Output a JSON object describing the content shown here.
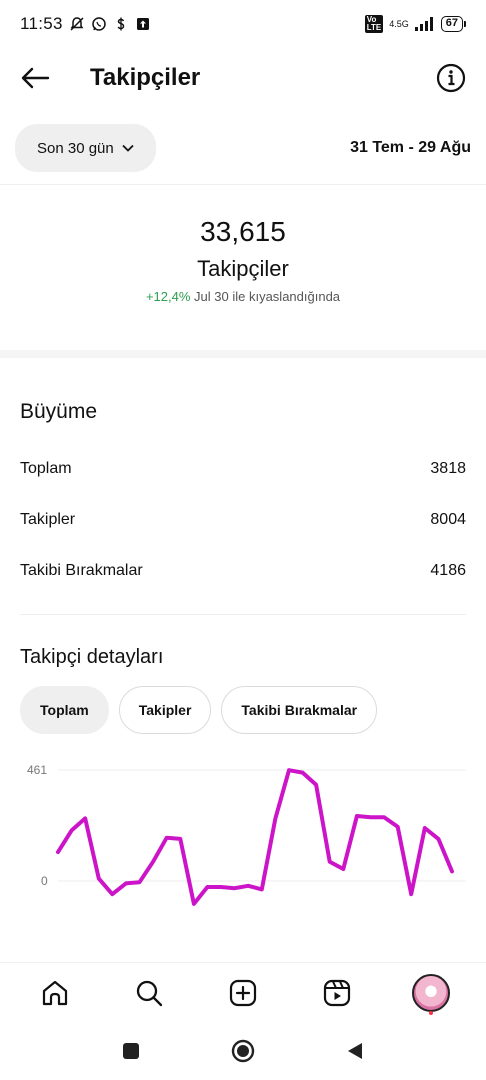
{
  "status_bar": {
    "time": "11:53",
    "network": "4.5G",
    "battery": "67"
  },
  "header": {
    "title": "Takipçiler"
  },
  "date_filter": {
    "range_label": "Son 30 gün",
    "date_range": "31 Tem - 29 Ağu"
  },
  "summary": {
    "count": "33,615",
    "label": "Takipçiler",
    "change": "+12,4%",
    "compare_text": "Jul 30 ile kıyaslandığında"
  },
  "growth": {
    "title": "Büyüme",
    "rows": [
      {
        "label": "Toplam",
        "value": "3818"
      },
      {
        "label": "Takipler",
        "value": "8004"
      },
      {
        "label": "Takibi Bırakmalar",
        "value": "4186"
      }
    ]
  },
  "details": {
    "title": "Takipçi detayları",
    "filters": [
      "Toplam",
      "Takipler",
      "Takibi Bırakmalar"
    ],
    "active_filter": "Toplam"
  },
  "chart_data": {
    "type": "line",
    "y_tick_labels": [
      "461",
      "0"
    ],
    "ylim": [
      0,
      461
    ],
    "color": "#cc14c8",
    "values": [
      120,
      210,
      260,
      10,
      -55,
      -10,
      -5,
      80,
      180,
      175,
      -95,
      -25,
      -25,
      -30,
      -20,
      -35,
      260,
      460,
      450,
      400,
      80,
      50,
      270,
      265,
      265,
      225,
      -55,
      220,
      175,
      40
    ]
  },
  "bottom_nav": {
    "items": [
      "home-icon",
      "search-icon",
      "create-icon",
      "reels-icon",
      "profile-avatar"
    ]
  },
  "system_nav": {
    "items": [
      "recents-button",
      "home-button",
      "back-button"
    ]
  }
}
